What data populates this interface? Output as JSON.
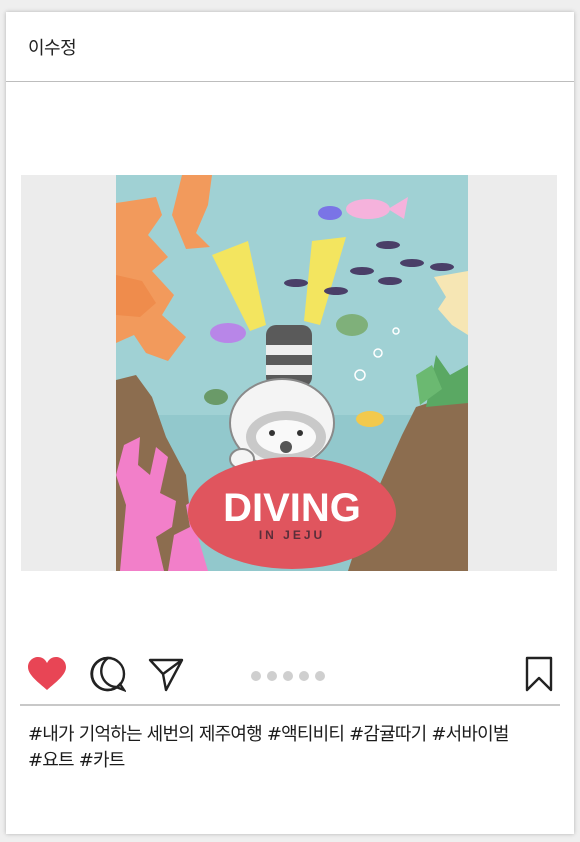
{
  "post": {
    "username": "이수정",
    "artwork": {
      "title": "DIVING",
      "subtitle": "IN JEJU",
      "colors": {
        "sea": "#9fd0d3",
        "coral_orange": "#f29a5c",
        "coral_pink": "#f27fc9",
        "rock": "#8c6d4f",
        "title_badge": "#e0555e",
        "fin": "#f3e55f"
      }
    },
    "actions": {
      "like_icon": "heart-icon",
      "comment_icon": "comment-icon",
      "share_icon": "send-icon",
      "save_icon": "bookmark-icon",
      "like_color": "#e84555"
    },
    "carousel": {
      "count": 5
    },
    "caption": [
      "#내가 기억하는 세번의 제주여행 #액티비티 #감귤따기 #서바이벌",
      "#요트 #카트"
    ]
  }
}
